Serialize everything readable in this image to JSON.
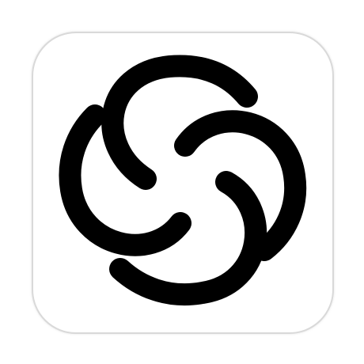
{
  "app_icon": {
    "icon_name": "four-swirl-knot-logo",
    "colors": {
      "background": "#ffffff",
      "border": "#d9d9d9",
      "mark": "#000000"
    }
  }
}
